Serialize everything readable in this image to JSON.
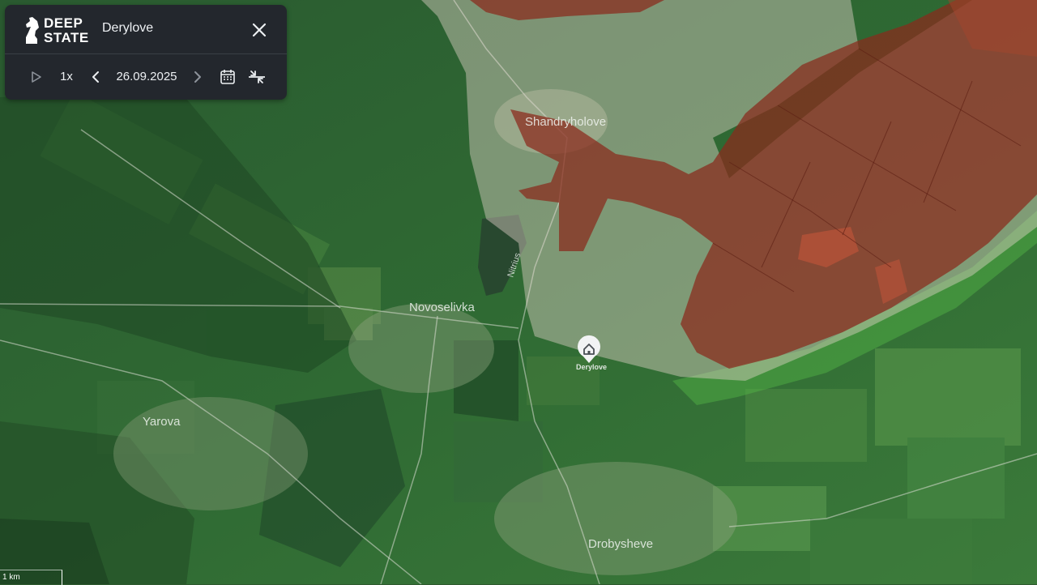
{
  "app": {
    "brand_line1": "DEEP",
    "brand_line2": "STATE",
    "title": "Derylove",
    "close_icon": "close-icon"
  },
  "controls": {
    "play_icon": "play-icon",
    "speed": "1x",
    "prev_icon": "chevron-left-icon",
    "date": "26.09.2025",
    "next_icon": "chevron-right-icon",
    "calendar_icon": "calendar-icon",
    "compare_icon": "compress-arrows-icon"
  },
  "map": {
    "places": {
      "shandryholove": "Shandryholove",
      "novoselivka": "Novoselivka",
      "yarova": "Yarova",
      "drobysheve": "Drobysheve"
    },
    "river": "Nitrius",
    "pin_label": "Derylove",
    "scale": "1 km",
    "colors": {
      "occupied": "#8b2a1c",
      "contested": "#e8c9c0",
      "liberated": "#4fb34a"
    }
  }
}
